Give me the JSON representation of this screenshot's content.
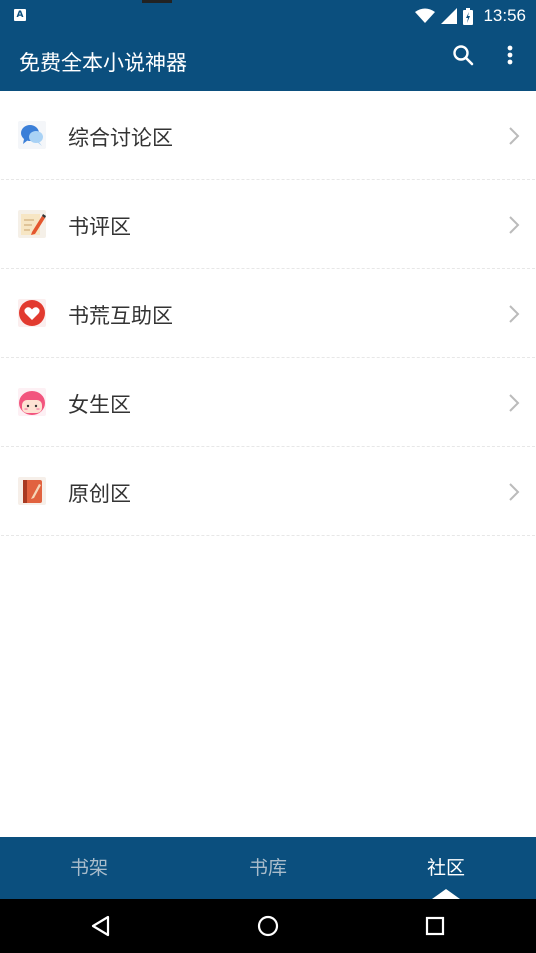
{
  "status_bar": {
    "time": "13:56",
    "notification_icon": "a-icon",
    "notification_glyph": "A",
    "icons": [
      "wifi-icon",
      "cell-signal-icon",
      "battery-icon"
    ]
  },
  "app_bar": {
    "title": "免费全本小说神器",
    "actions": [
      "search-icon",
      "more-vert-icon"
    ],
    "color": "#0b4f7e"
  },
  "forums": [
    {
      "label": "综合讨论区",
      "icon": "chat-bubbles-icon"
    },
    {
      "label": "书评区",
      "icon": "pencil-note-icon"
    },
    {
      "label": "书荒互助区",
      "icon": "heart-icon"
    },
    {
      "label": "女生区",
      "icon": "girl-face-icon"
    },
    {
      "label": "原创区",
      "icon": "notebook-icon"
    }
  ],
  "bottom_nav": {
    "tabs": [
      "书架",
      "书库",
      "社区"
    ],
    "active": "社区"
  },
  "system_nav": [
    "back-icon",
    "home-icon",
    "recents-icon"
  ]
}
